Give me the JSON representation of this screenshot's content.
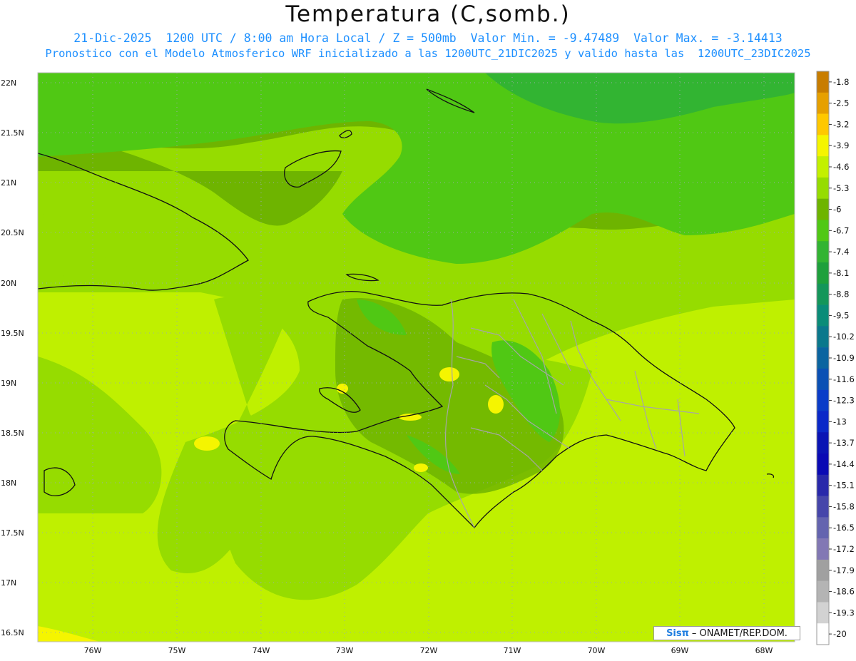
{
  "title": "Temperatura (C,somb.)",
  "subtitle_line1": "21-Dic-2025  1200 UTC / 8:00 am Hora Local / Z = 500mb  Valor Min. = -9.47489  Valor Max. = -3.14413",
  "subtitle_line2": "Pronostico con el Modelo Atmosferico WRF inicializado a las 1200UTC_21DIC2025 y valido hasta las  1200UTC_23DIC2025",
  "credit": {
    "logo": "Sisπ",
    "text": "– ONAMET/REP.DOM."
  },
  "map": {
    "lat_ticks": [
      "22N",
      "21.5N",
      "21N",
      "20.5N",
      "20N",
      "19.5N",
      "19N",
      "18.5N",
      "18N",
      "17.5N",
      "17N",
      "16.5N"
    ],
    "lon_ticks": [
      "76W",
      "75W",
      "74W",
      "73W",
      "72W",
      "71W",
      "70W",
      "69W",
      "68W"
    ]
  },
  "colorbar": {
    "labels": [
      "-1.8",
      "-2.5",
      "-3.2",
      "-3.9",
      "-4.6",
      "-5.3",
      "-6",
      "-6.7",
      "-7.4",
      "-8.1",
      "-8.8",
      "-9.5",
      "-10.2",
      "-10.9",
      "-11.6",
      "-12.3",
      "-13",
      "-13.7",
      "-14.4",
      "-15.1",
      "-15.8",
      "-16.5",
      "-17.2",
      "-17.9",
      "-18.6",
      "-19.3",
      "-20"
    ],
    "colors": [
      "#c87d00",
      "#e6a000",
      "#ffc800",
      "#f5f500",
      "#c3f000",
      "#96dc00",
      "#6eb400",
      "#50c814",
      "#32b432",
      "#1ea03c",
      "#14965a",
      "#0a8c78",
      "#0a788c",
      "#0a64a0",
      "#0a50b4",
      "#0a3cc8",
      "#0a28c8",
      "#0a14b4",
      "#0a0ab4",
      "#2828aa",
      "#4646aa",
      "#6464af",
      "#8278b4",
      "#a0a0a0",
      "#b4b4b4",
      "#d2d2d2",
      "#ffffff"
    ]
  }
}
